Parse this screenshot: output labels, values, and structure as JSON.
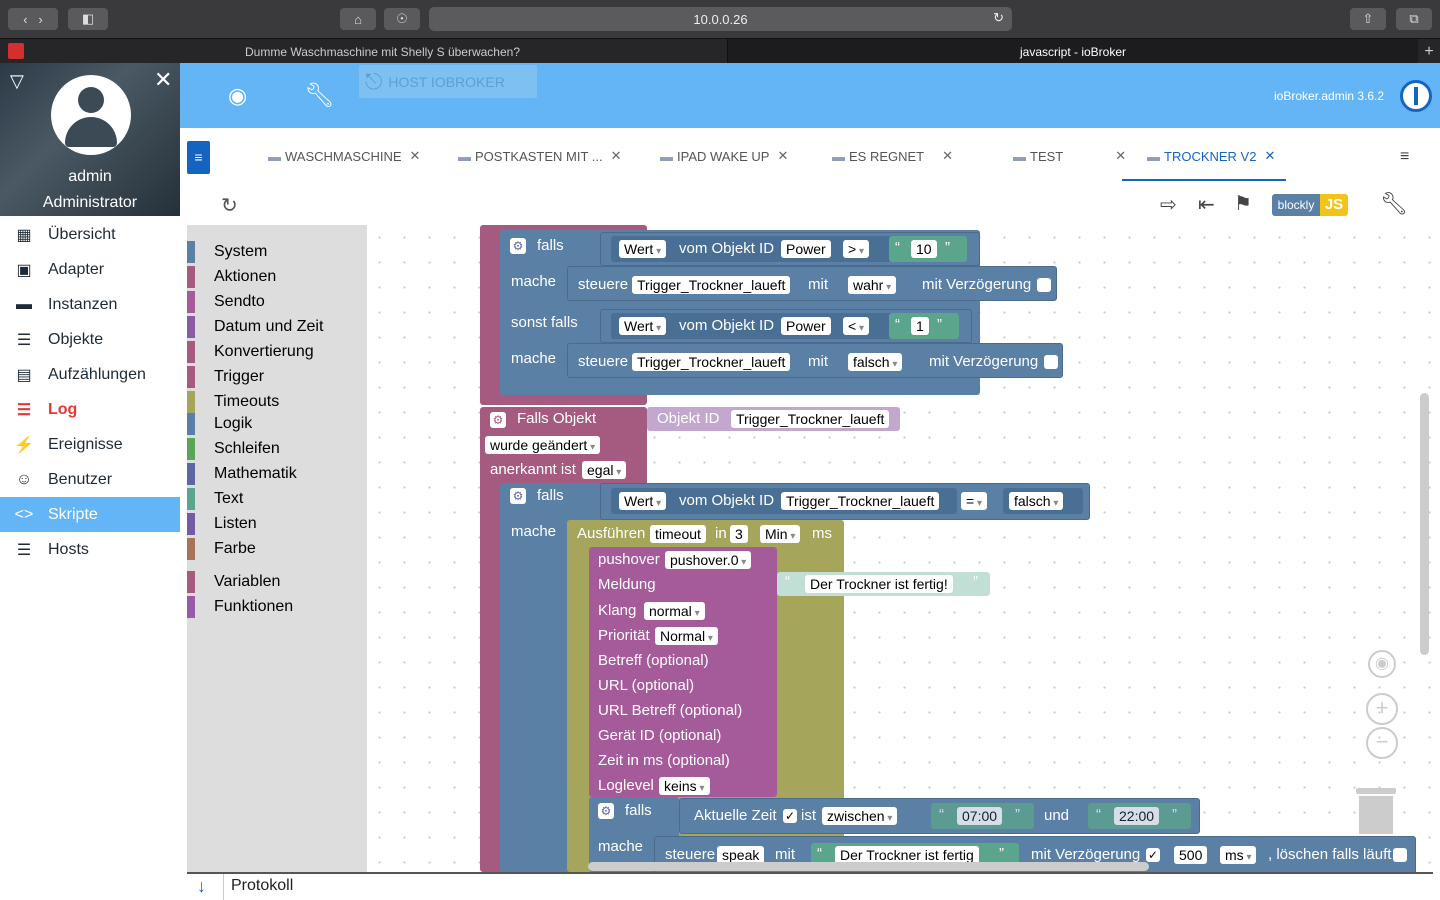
{
  "browser": {
    "url": "10.0.0.26",
    "tabs": [
      "Dumme Waschmaschine mit Shelly S überwachen?",
      "javascript - ioBroker"
    ]
  },
  "sidebar": {
    "user_name": "admin",
    "user_role": "Administrator",
    "items": [
      {
        "label": "Übersicht",
        "icon": "grid-icon"
      },
      {
        "label": "Adapter",
        "icon": "store-icon"
      },
      {
        "label": "Instanzen",
        "icon": "instances-icon"
      },
      {
        "label": "Objekte",
        "icon": "list-icon"
      },
      {
        "label": "Aufzählungen",
        "icon": "enum-icon"
      },
      {
        "label": "Log",
        "icon": "menu-icon"
      },
      {
        "label": "Ereignisse",
        "icon": "bolt-icon"
      },
      {
        "label": "Benutzer",
        "icon": "user-icon"
      },
      {
        "label": "Skripte",
        "icon": "code-icon"
      },
      {
        "label": "Hosts",
        "icon": "hosts-icon"
      }
    ]
  },
  "header": {
    "host_label": "HOST IOBROKER",
    "version": "ioBroker.admin 3.6.2"
  },
  "script_tabs": [
    "WASCHMASCHINE",
    "POSTKASTEN MIT ...",
    "IPAD WAKE UP",
    "ES REGNET",
    "TEST",
    "TROCKNER V2"
  ],
  "editor_toggle": {
    "blockly": "blockly",
    "js": "JS"
  },
  "toolbox": {
    "group1": [
      {
        "label": "System",
        "color": "#5b80a5"
      },
      {
        "label": "Aktionen",
        "color": "#a55b80"
      },
      {
        "label": "Sendto",
        "color": "#a55b9a"
      },
      {
        "label": "Datum und Zeit",
        "color": "#8a5ba5"
      },
      {
        "label": "Konvertierung",
        "color": "#a55b80"
      },
      {
        "label": "Trigger",
        "color": "#a55b80"
      },
      {
        "label": "Timeouts",
        "color": "#a5a55b"
      }
    ],
    "group2": [
      {
        "label": "Logik",
        "color": "#5b80a5"
      },
      {
        "label": "Schleifen",
        "color": "#5ba55b"
      },
      {
        "label": "Mathematik",
        "color": "#5b67a5"
      },
      {
        "label": "Text",
        "color": "#5ba58c"
      },
      {
        "label": "Listen",
        "color": "#745ba5"
      },
      {
        "label": "Farbe",
        "color": "#a5745b"
      }
    ],
    "group3": [
      {
        "label": "Variablen",
        "color": "#a55b80"
      },
      {
        "label": "Funktionen",
        "color": "#995ba5"
      }
    ]
  },
  "blocks": {
    "falls": "falls",
    "mache": "mache",
    "sonst_falls": "sonst falls",
    "wert": "Wert",
    "vom_objekt_id": "vom Objekt ID",
    "power": "Power",
    "op_gt": ">",
    "op_lt": "<",
    "op_eq": "=",
    "num_10": "10",
    "num_1": "1",
    "steuere": "steuere",
    "trigger_var": "Trigger_Trockner_laueft",
    "mit": "mit",
    "wahr": "wahr",
    "falsch": "falsch",
    "mit_verzoegerung": "mit Verzögerung",
    "falls_objekt": "Falls Objekt",
    "objekt_id": "Objekt ID",
    "wurde_geaendert": "wurde geändert",
    "anerkannt_ist": "anerkannt ist",
    "egal": "egal",
    "ausfuehren": "Ausführen",
    "timeout": "timeout",
    "in": "in",
    "num_3": "3",
    "min": "Min",
    "ms": "ms",
    "pushover": "pushover",
    "pushover_inst": "pushover.0",
    "meldung": "Meldung",
    "meldung_text": "Der Trockner ist fertig!",
    "klang": "Klang",
    "klang_val": "normal",
    "prioritaet": "Priorität",
    "prioritaet_val": "Normal",
    "betreff": "Betreff (optional)",
    "url": "URL (optional)",
    "url_betreff": "URL Betreff (optional)",
    "geraet_id": "Gerät ID (optional)",
    "zeit_ms": "Zeit in ms (optional)",
    "loglevel": "Loglevel",
    "keins": "keins",
    "aktuelle_zeit": "Aktuelle Zeit",
    "ist": "ist",
    "zwischen": "zwischen",
    "time_from": "07:00",
    "und": "und",
    "time_to": "22:00",
    "speak": "speak",
    "speak_text": "Der Trockner ist fertig",
    "num_500": "500",
    "loeschen": ", löschen falls läuft"
  },
  "statusbar": {
    "label": "Protokoll"
  }
}
